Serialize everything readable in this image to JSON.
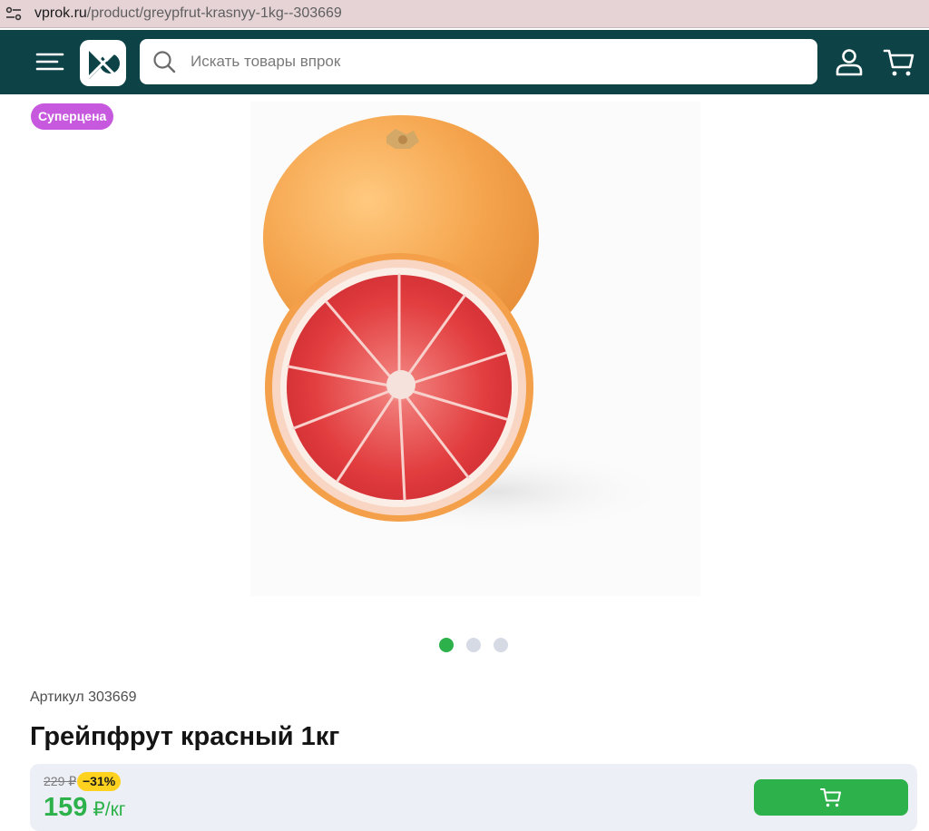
{
  "browser": {
    "url_host": "vprok.ru",
    "url_path": "/product/greypfrut-krasnyy-1kg--303669"
  },
  "header": {
    "search_placeholder": "Искать товары впрок",
    "icons": [
      "menu-icon",
      "logo-icon",
      "search-icon",
      "user-icon",
      "cart-icon"
    ],
    "colors": {
      "header_bg": "#0d4347",
      "accent": "#2db24b"
    }
  },
  "product": {
    "badge": "Суперцена",
    "badge_color": "#c659dd",
    "image_alt": "grapefruit",
    "carousel": {
      "total": 3,
      "active": 1
    },
    "sku": "Артикул 303669",
    "title": "Грейпфрут красный 1кг",
    "price": {
      "old": "229 ₽",
      "discount": "−31%",
      "current": "159",
      "unit": "₽/кг"
    }
  }
}
